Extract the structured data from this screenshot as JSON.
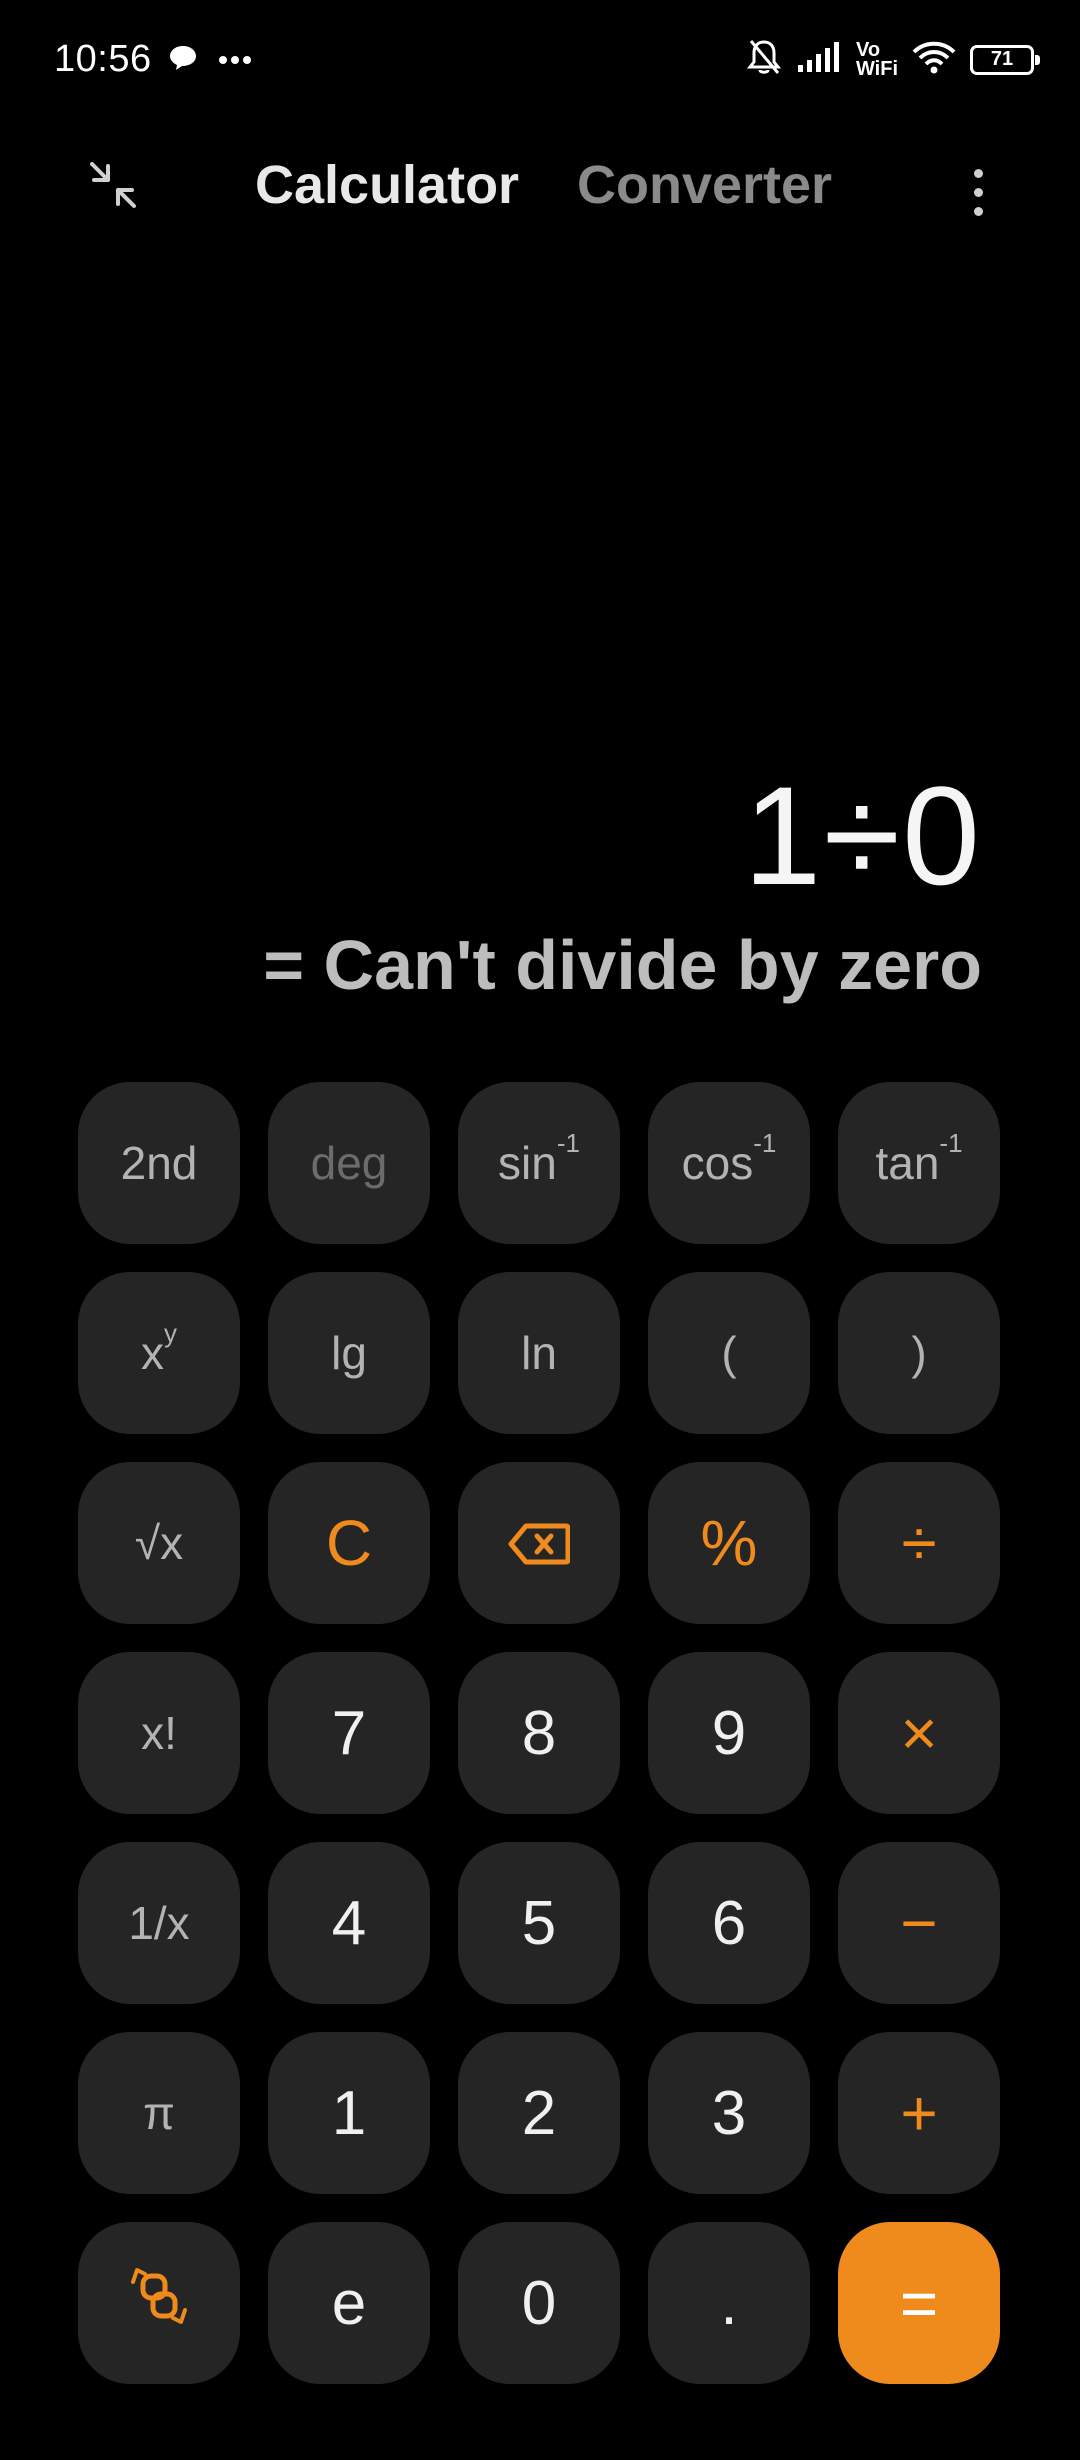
{
  "status_bar": {
    "time": "10:56",
    "network_label": "Vo\nWiFi",
    "battery_level": "71",
    "icons": [
      "chat-bubble-icon",
      "more-dots-icon",
      "mute-bell-icon",
      "signal-icon",
      "wifi-icon",
      "battery-icon"
    ]
  },
  "header": {
    "tabs": [
      {
        "label": "Calculator",
        "active": true
      },
      {
        "label": "Converter",
        "active": false
      }
    ],
    "collapse_icon": "collapse-arrows-icon",
    "menu_icon": "more-vertical-icon"
  },
  "display": {
    "expression": "1÷0",
    "result": "= Can't divide by zero"
  },
  "keypad": {
    "row1": [
      "2nd",
      "deg",
      "sin",
      "cos",
      "tan"
    ],
    "superscript_inverse": "-1",
    "row2": [
      "x",
      "lg",
      "ln",
      "(",
      ")"
    ],
    "power_superscript": "y",
    "row3": [
      "√x",
      "C",
      "backspace",
      "%",
      "÷"
    ],
    "row4": [
      "x!",
      "7",
      "8",
      "9",
      "×"
    ],
    "row5": [
      "1/x",
      "4",
      "5",
      "6",
      "−"
    ],
    "row6": [
      "π",
      "1",
      "2",
      "3",
      "+"
    ],
    "row7": [
      "swap",
      "e",
      "0",
      ".",
      "="
    ]
  },
  "colors": {
    "accent": "#ef8a1c",
    "key_bg": "#252525",
    "background": "#000000"
  }
}
